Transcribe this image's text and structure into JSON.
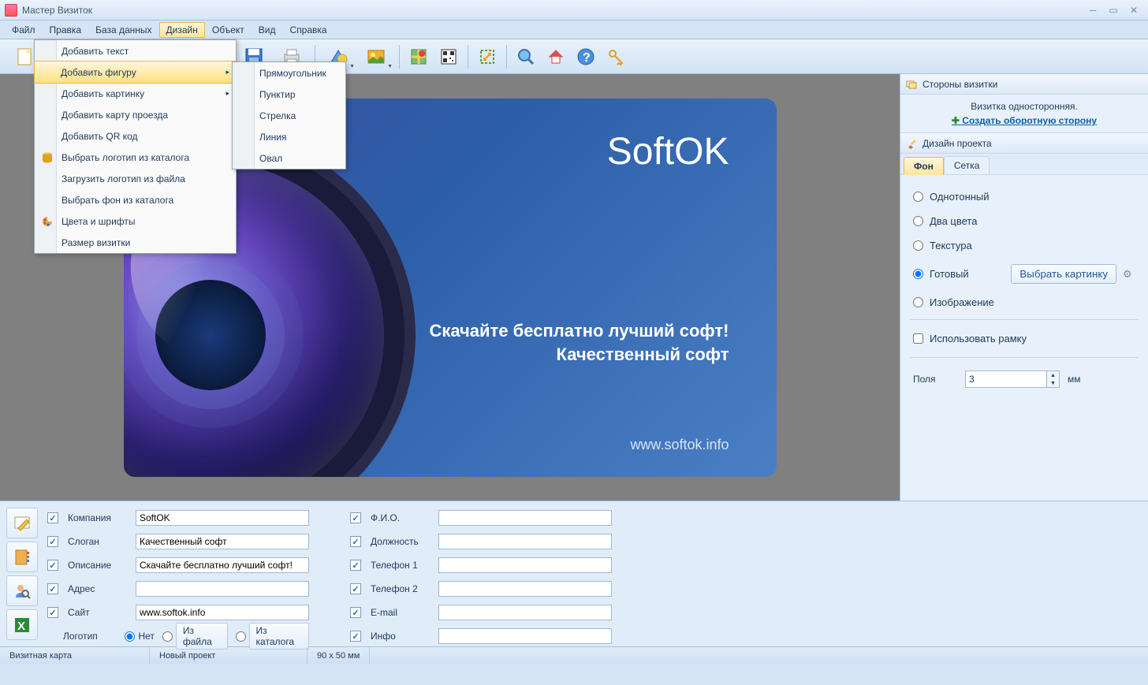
{
  "app": {
    "title": "Мастер Визиток"
  },
  "menubar": {
    "file": "Файл",
    "edit": "Правка",
    "database": "База данных",
    "design": "Дизайн",
    "object": "Объект",
    "view": "Вид",
    "help": "Справка"
  },
  "design_menu": {
    "add_text": "Добавить текст",
    "add_shape": "Добавить фигуру",
    "add_image": "Добавить картинку",
    "add_map": "Добавить карту проезда",
    "add_qr": "Добавить QR код",
    "pick_logo_catalog": "Выбрать логотип из каталога",
    "load_logo_file": "Загрузить логотип из файла",
    "pick_bg_catalog": "Выбрать фон из каталога",
    "colors_fonts": "Цвета и шрифты",
    "card_size": "Размер визитки"
  },
  "shape_submenu": {
    "rectangle": "Прямоугольник",
    "dashed": "Пунктир",
    "arrow": "Стрелка",
    "line": "Линия",
    "oval": "Овал"
  },
  "card": {
    "brand": "SoftOK",
    "line1": "Скачайте бесплатно лучший софт!",
    "line2": "Качественный софт",
    "url": "www.softok.info"
  },
  "right": {
    "sides_header": "Стороны визитки",
    "single_side": "Визитка односторонняя.",
    "create_back": "Создать оборотную сторону",
    "design_header": "Дизайн проекта",
    "tab_bg": "Фон",
    "tab_grid": "Сетка",
    "solid": "Однотонный",
    "two_colors": "Два цвета",
    "texture": "Текстура",
    "ready": "Готовый",
    "select_image": "Выбрать картинку",
    "image": "Изображение",
    "use_frame": "Использовать рамку",
    "margins_label": "Поля",
    "margins_value": "3",
    "margins_unit": "мм"
  },
  "form": {
    "company_label": "Компания",
    "company_value": "SoftOK",
    "slogan_label": "Слоган",
    "slogan_value": "Качественный софт",
    "desc_label": "Описание",
    "desc_value": "Скачайте бесплатно лучший софт!",
    "address_label": "Адрес",
    "address_value": "",
    "site_label": "Сайт",
    "site_value": "www.softok.info",
    "logo_label": "Логотип",
    "logo_none": "Нет",
    "logo_file": "Из файла",
    "logo_catalog": "Из каталога",
    "fio_label": "Ф.И.О.",
    "position_label": "Должность",
    "phone1_label": "Телефон 1",
    "phone2_label": "Телефон 2",
    "email_label": "E-mail",
    "info_label": "Инфо"
  },
  "status": {
    "type": "Визитная карта",
    "project": "Новый проект",
    "size": "90 x 50 мм"
  }
}
